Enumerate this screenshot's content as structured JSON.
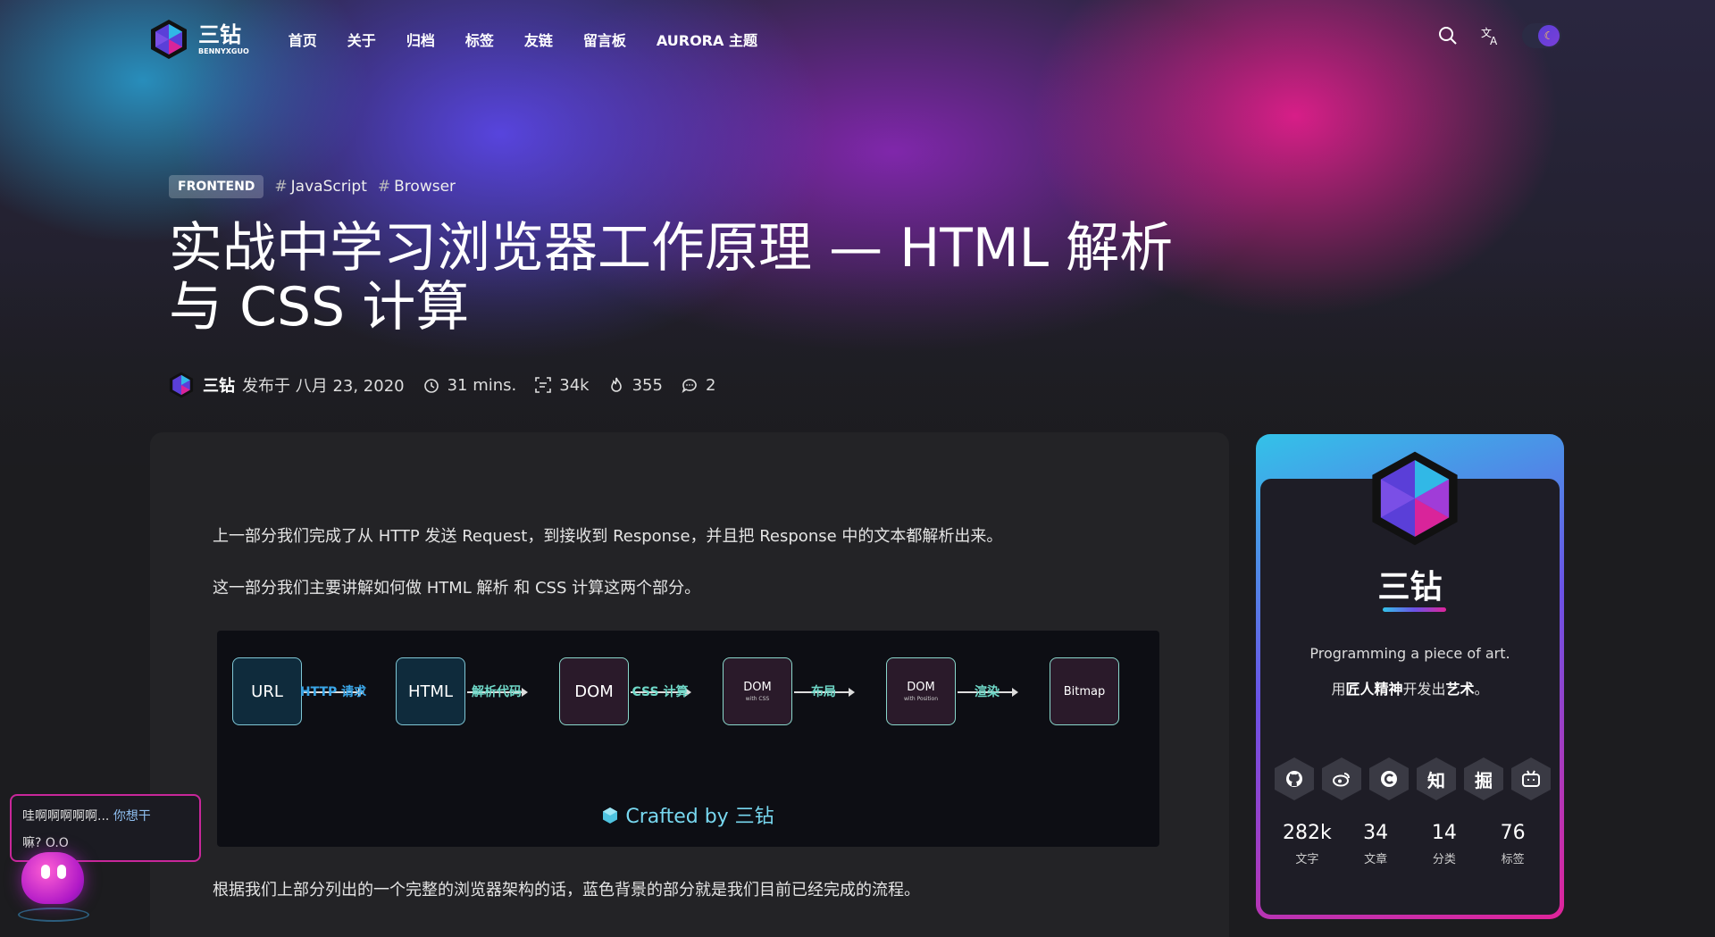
{
  "site": {
    "brand_name": "三钻",
    "brand_sub": "BENNYXGUO",
    "nav": [
      "首页",
      "关于",
      "归档",
      "标签",
      "友链",
      "留言板",
      "AURORA 主题"
    ],
    "tools": {
      "search": "search-icon",
      "translate": "translate-icon",
      "theme_toggle": "moon-icon"
    }
  },
  "post": {
    "category": "FRONTEND",
    "tags": [
      "JavaScript",
      "Browser"
    ],
    "title": "实战中学习浏览器工作原理 — HTML 解析与 CSS 计算",
    "author": "三钻",
    "published": "发布于 八月 23, 2020",
    "read_time": "31 mins.",
    "word_count": "34k",
    "views": "355",
    "comments": "2"
  },
  "article": {
    "paragraphs": [
      "上一部分我们完成了从 HTTP 发送 Request，到接收到 Response，并且把 Response 中的文本都解析出来。",
      "这一部分我们主要讲解如何做 HTML 解析 和 CSS 计算这两个部分。",
      "根据我们上部分列出的一个完整的浏览器架构的话，蓝色背景的部分就是我们目前已经完成的流程。"
    ],
    "diagram": {
      "nodes": [
        {
          "label": "URL",
          "sub": ""
        },
        {
          "label": "HTML",
          "sub": ""
        },
        {
          "label": "DOM",
          "sub": ""
        },
        {
          "label": "DOM",
          "sub": "with CSS"
        },
        {
          "label": "DOM",
          "sub": "with Position"
        },
        {
          "label": "Bitmap",
          "sub": ""
        }
      ],
      "edges": [
        "HTTP 请求",
        "解析代码",
        "CSS 计算",
        "布局",
        "渲染"
      ],
      "crafted_by": "Crafted by 三钻"
    }
  },
  "profile": {
    "name": "三钻",
    "slogan_en": "Programming a piece of art.",
    "slogan_cn_parts": [
      "用",
      "匠人精神",
      "开发出",
      "艺术",
      "。"
    ],
    "socials": [
      {
        "icon": "github-icon",
        "label": ""
      },
      {
        "icon": "weibo-icon",
        "label": ""
      },
      {
        "icon": "csdn-icon",
        "label": ""
      },
      {
        "icon": "zhihu-icon",
        "label": "知"
      },
      {
        "icon": "juejin-icon",
        "label": "掘"
      },
      {
        "icon": "bilibili-icon",
        "label": ""
      }
    ],
    "stats": [
      {
        "num": "282k",
        "label": "文字"
      },
      {
        "num": "34",
        "label": "文章"
      },
      {
        "num": "14",
        "label": "分类"
      },
      {
        "num": "76",
        "label": "标签"
      }
    ]
  },
  "mascot": {
    "text_main": "哇啊啊啊啊啊...",
    "text_highlight": "你想干",
    "text_end": "嘛? O.O"
  },
  "colors": {
    "accent_blue": "#33c2e8",
    "accent_purple": "#6b52e6",
    "accent_pink": "#e0249a"
  }
}
